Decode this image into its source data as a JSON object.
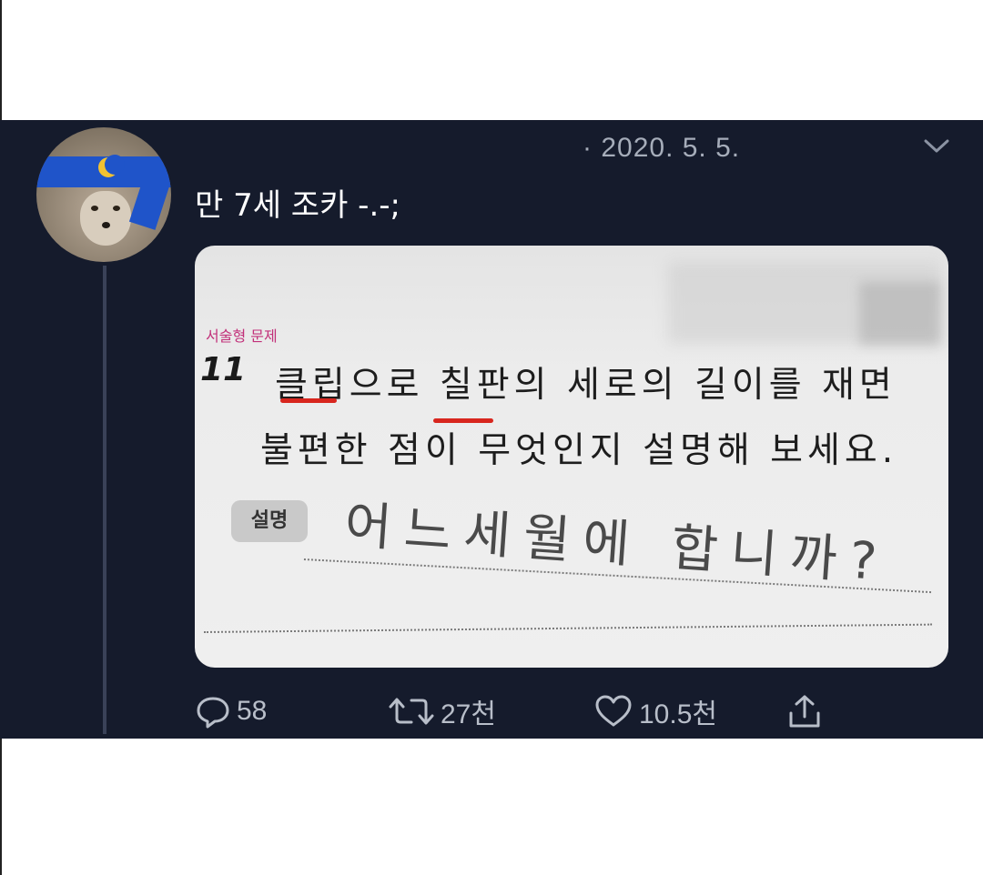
{
  "tweet": {
    "date": "· 2020. 5. 5.",
    "text": "만 7세 조카 -.-;",
    "menu_icon": "chevron-down-icon"
  },
  "media": {
    "question_label": "서술형 문제",
    "question_number": "11",
    "question_line1": "클립으로 칠판의 세로의 길이를 재면",
    "question_line2": "불편한 점이 무엇인지 설명해 보세요.",
    "answer_tag": "설명",
    "handwritten_answer": "어느세월에 합니까?"
  },
  "actions": {
    "reply_count": "58",
    "retweet_count": "27천",
    "like_count": "10.5천",
    "icons": [
      "reply-icon",
      "retweet-icon",
      "like-icon",
      "share-icon"
    ]
  },
  "colors": {
    "background": "#151b2c",
    "text": "#ffffff",
    "muted": "#a6adba",
    "underline_red": "#d8261e",
    "label_pink": "#c2317a"
  }
}
